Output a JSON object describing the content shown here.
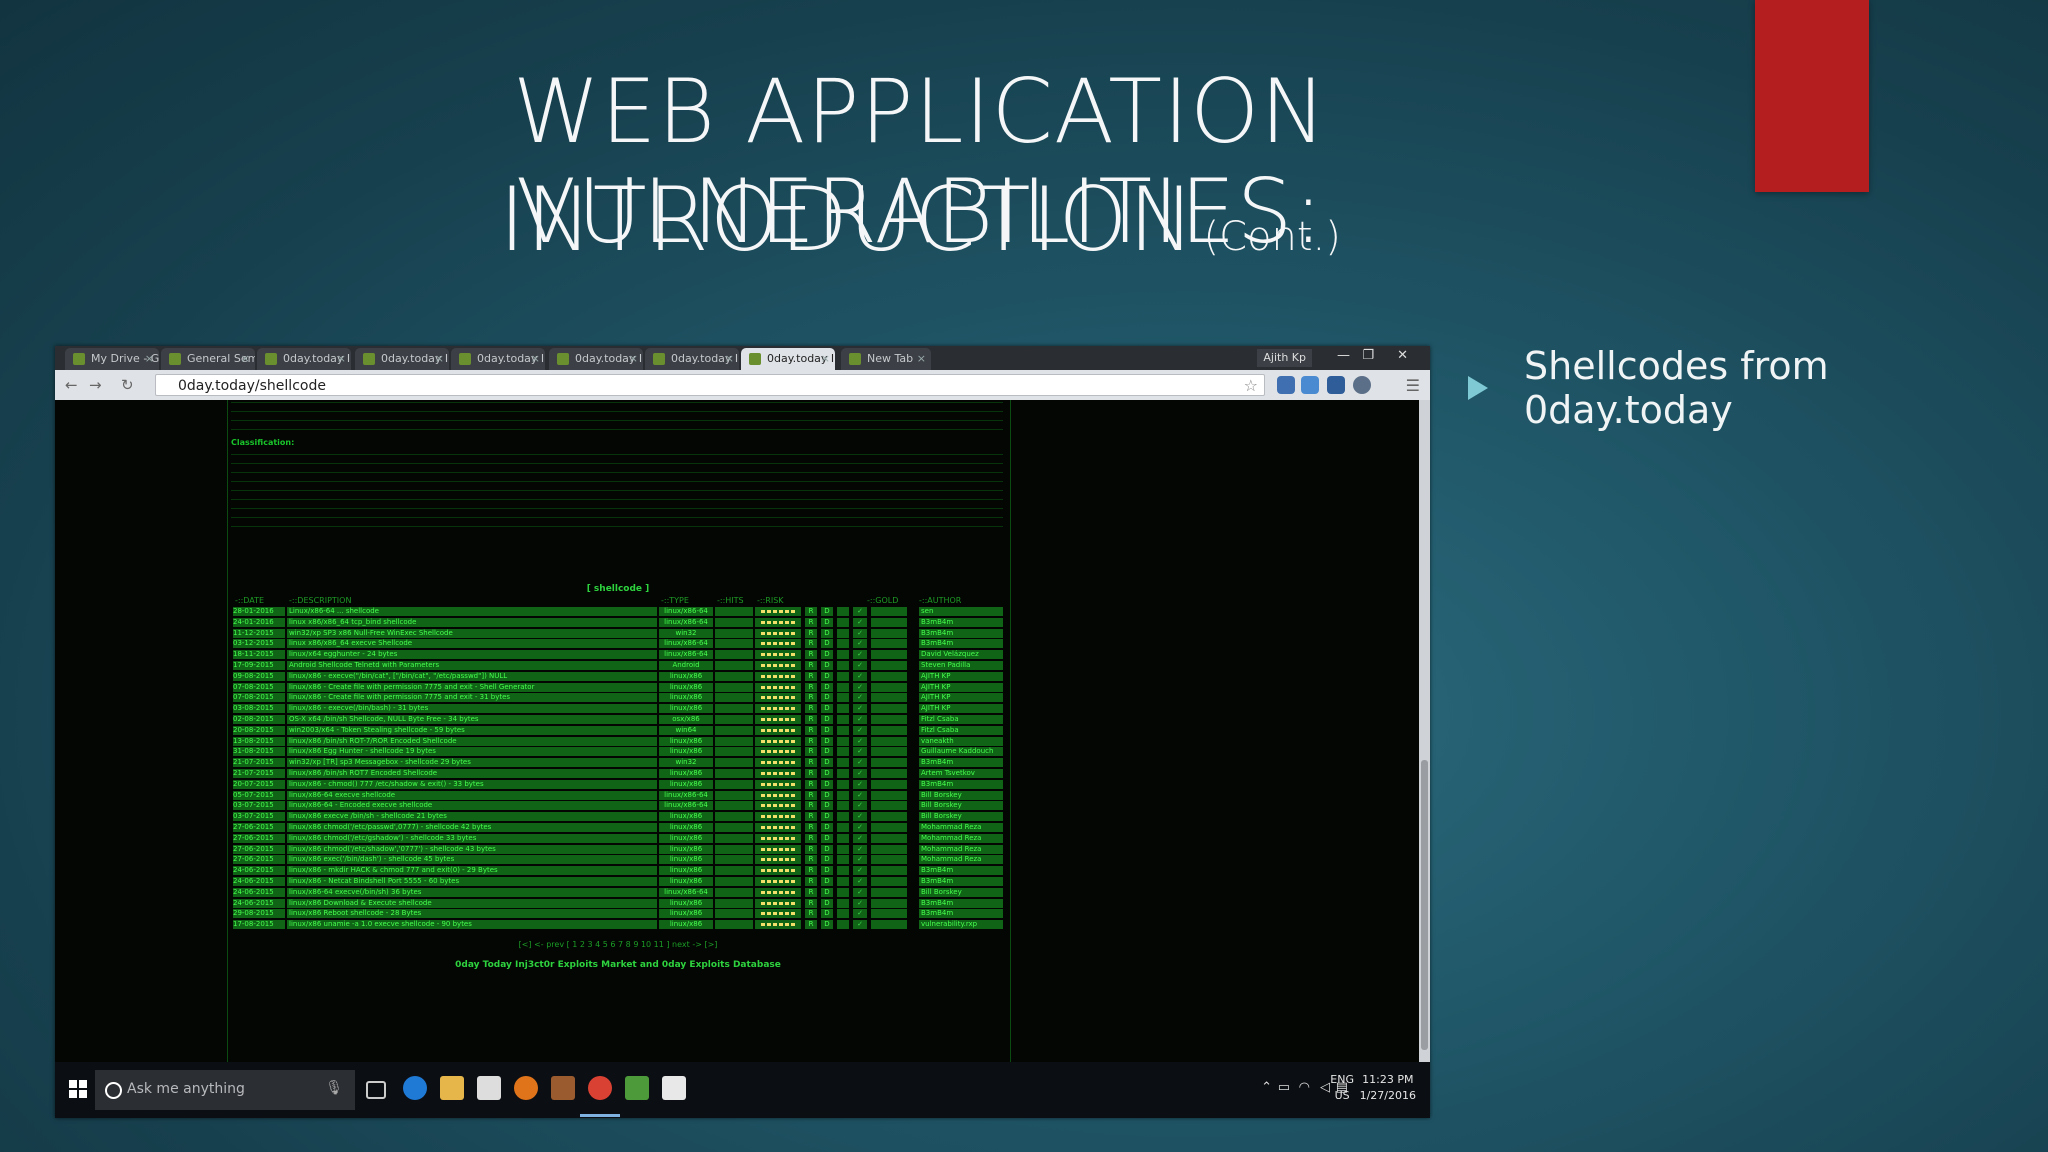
{
  "slide": {
    "title_line1": "WEB APPLICATION VULNERABILITIES:",
    "title_line2": "INTRODUCTION",
    "title_suffix": "(Cont.)",
    "bullet": "Shellcodes from 0day.today",
    "accent_color": "#b41e1e",
    "bullet_color": "#7ec9d3"
  },
  "browser": {
    "tabs": [
      "My Drive - G",
      "General Sem",
      "0day.today In",
      "0day.today In",
      "0day.today In",
      "0day.today In",
      "0day.today In",
      "0day.today In",
      "New Tab"
    ],
    "active_tab_index": 7,
    "user": "Ajith Kp",
    "url": "0day.today/shellcode"
  },
  "page": {
    "classification_heading": "Classification:",
    "shellcode_title": "[ shellcode ]",
    "columns": [
      "-::DATE",
      "-::DESCRIPTION",
      "-::TYPE",
      "-::HITS",
      "-::RISK",
      "-::GOLD",
      "-::AUTHOR"
    ],
    "rows": [
      {
        "date": "28-01-2016",
        "desc": "Linux/x86-64 ... shellcode",
        "type": "linux/x86-64",
        "author": "sen"
      },
      {
        "date": "24-01-2016",
        "desc": "linux x86/x86_64 tcp_bind shellcode",
        "type": "linux/x86-64",
        "author": "B3mB4m"
      },
      {
        "date": "11-12-2015",
        "desc": "win32/xp SP3 x86 Null-Free WinExec Shellcode",
        "type": "win32",
        "author": "B3mB4m"
      },
      {
        "date": "03-12-2015",
        "desc": "linux x86/x86_64 execve Shellcode",
        "type": "linux/x86-64",
        "author": "B3mB4m"
      },
      {
        "date": "18-11-2015",
        "desc": "linux/x64 egghunter - 24 bytes",
        "type": "linux/x86-64",
        "author": "David Velázquez"
      },
      {
        "date": "17-09-2015",
        "desc": "Android Shellcode Telnetd with Parameters",
        "type": "Android",
        "author": "Steven Padilla"
      },
      {
        "date": "09-08-2015",
        "desc": "linux/x86 - execve(\"/bin/cat\", [\"/bin/cat\", \"/etc/passwd\"]) NULL",
        "type": "linux/x86",
        "author": "AJITH KP"
      },
      {
        "date": "07-08-2015",
        "desc": "linux/x86 - Create file with permission 7775 and exit - Shell Generator",
        "type": "linux/x86",
        "author": "AJITH KP"
      },
      {
        "date": "07-08-2015",
        "desc": "linux/x86 - Create file with permission 7775 and exit - 31 bytes",
        "type": "linux/x86",
        "author": "AJITH KP"
      },
      {
        "date": "03-08-2015",
        "desc": "linux/x86 - execve(/bin/bash) - 31 bytes",
        "type": "linux/x86",
        "author": "AJITH KP"
      },
      {
        "date": "02-08-2015",
        "desc": "OS-X x64 /bin/sh Shellcode, NULL Byte Free - 34 bytes",
        "type": "osx/x86",
        "author": "Fitzl Csaba"
      },
      {
        "date": "20-08-2015",
        "desc": "win2003/x64 - Token Stealing shellcode - 59 bytes",
        "type": "win64",
        "author": "Fitzl Csaba"
      },
      {
        "date": "13-08-2015",
        "desc": "linux/x86 /bin/sh ROT-7/ROR Encoded Shellcode",
        "type": "linux/x86",
        "author": "vaneakth"
      },
      {
        "date": "31-08-2015",
        "desc": "linux/x86 Egg Hunter - shellcode 19 bytes",
        "type": "linux/x86",
        "author": "Guillaume Kaddouch"
      },
      {
        "date": "21-07-2015",
        "desc": "win32/xp [TR] sp3 Messagebox - shellcode 29 bytes",
        "type": "win32",
        "author": "B3mB4m"
      },
      {
        "date": "21-07-2015",
        "desc": "linux/x86 /bin/sh ROT7 Encoded Shellcode",
        "type": "linux/x86",
        "author": "Artem Tsvetkov"
      },
      {
        "date": "20-07-2015",
        "desc": "linux/x86 - chmod() 777 /etc/shadow & exit() - 33 bytes",
        "type": "linux/x86",
        "author": "B3mB4m"
      },
      {
        "date": "05-07-2015",
        "desc": "linux/x86-64 execve shellcode",
        "type": "linux/x86-64",
        "author": "Bill Borskey"
      },
      {
        "date": "03-07-2015",
        "desc": "linux/x86-64 - Encoded execve shellcode",
        "type": "linux/x86-64",
        "author": "Bill Borskey"
      },
      {
        "date": "03-07-2015",
        "desc": "linux/x86 execve /bin/sh - shellcode 21 bytes",
        "type": "linux/x86",
        "author": "Bill Borskey"
      },
      {
        "date": "27-06-2015",
        "desc": "linux/x86 chmod('/etc/passwd',0777) - shellcode 42 bytes",
        "type": "linux/x86",
        "author": "Mohammad Reza"
      },
      {
        "date": "27-06-2015",
        "desc": "linux/x86 chmod('/etc/gshadow') - shellcode 33 bytes",
        "type": "linux/x86",
        "author": "Mohammad Reza"
      },
      {
        "date": "27-06-2015",
        "desc": "linux/x86 chmod('/etc/shadow','0777') - shellcode 43 bytes",
        "type": "linux/x86",
        "author": "Mohammad Reza"
      },
      {
        "date": "27-06-2015",
        "desc": "linux/x86 exec('/bin/dash') - shellcode 45 bytes",
        "type": "linux/x86",
        "author": "Mohammad Reza"
      },
      {
        "date": "24-06-2015",
        "desc": "linux/x86 - mkdir HACK & chmod 777 and exit(0) - 29 Bytes",
        "type": "linux/x86",
        "author": "B3mB4m"
      },
      {
        "date": "24-06-2015",
        "desc": "linux/x86 - Netcat Bindshell Port 5555 - 60 bytes",
        "type": "linux/x86",
        "author": "B3mB4m"
      },
      {
        "date": "24-06-2015",
        "desc": "linux/x86-64 execve(/bin/sh) 36 bytes",
        "type": "linux/x86-64",
        "author": "Bill Borskey"
      },
      {
        "date": "24-06-2015",
        "desc": "linux/x86 Download & Execute shellcode",
        "type": "linux/x86",
        "author": "B3mB4m"
      },
      {
        "date": "29-08-2015",
        "desc": "linux/x86 Reboot shellcode - 28 Bytes",
        "type": "linux/x86",
        "author": "B3mB4m"
      },
      {
        "date": "17-08-2015",
        "desc": "linux/x86 unamie -a 1.0 execve shellcode - 90 bytes",
        "type": "linux/x86",
        "author": "vulnerability.rxp"
      }
    ],
    "pager": "[<] <- prev [ 1 2 3 4 5 6 7 8 9 10 11 ] next -> [>]",
    "footer": "0day Today Inj3ct0r Exploits Market and 0day Exploits Database"
  },
  "taskbar": {
    "search_placeholder": "Ask me anything",
    "lang_line1": "ENG",
    "lang_line2": "US",
    "time": "11:23 PM",
    "date": "1/27/2016"
  }
}
